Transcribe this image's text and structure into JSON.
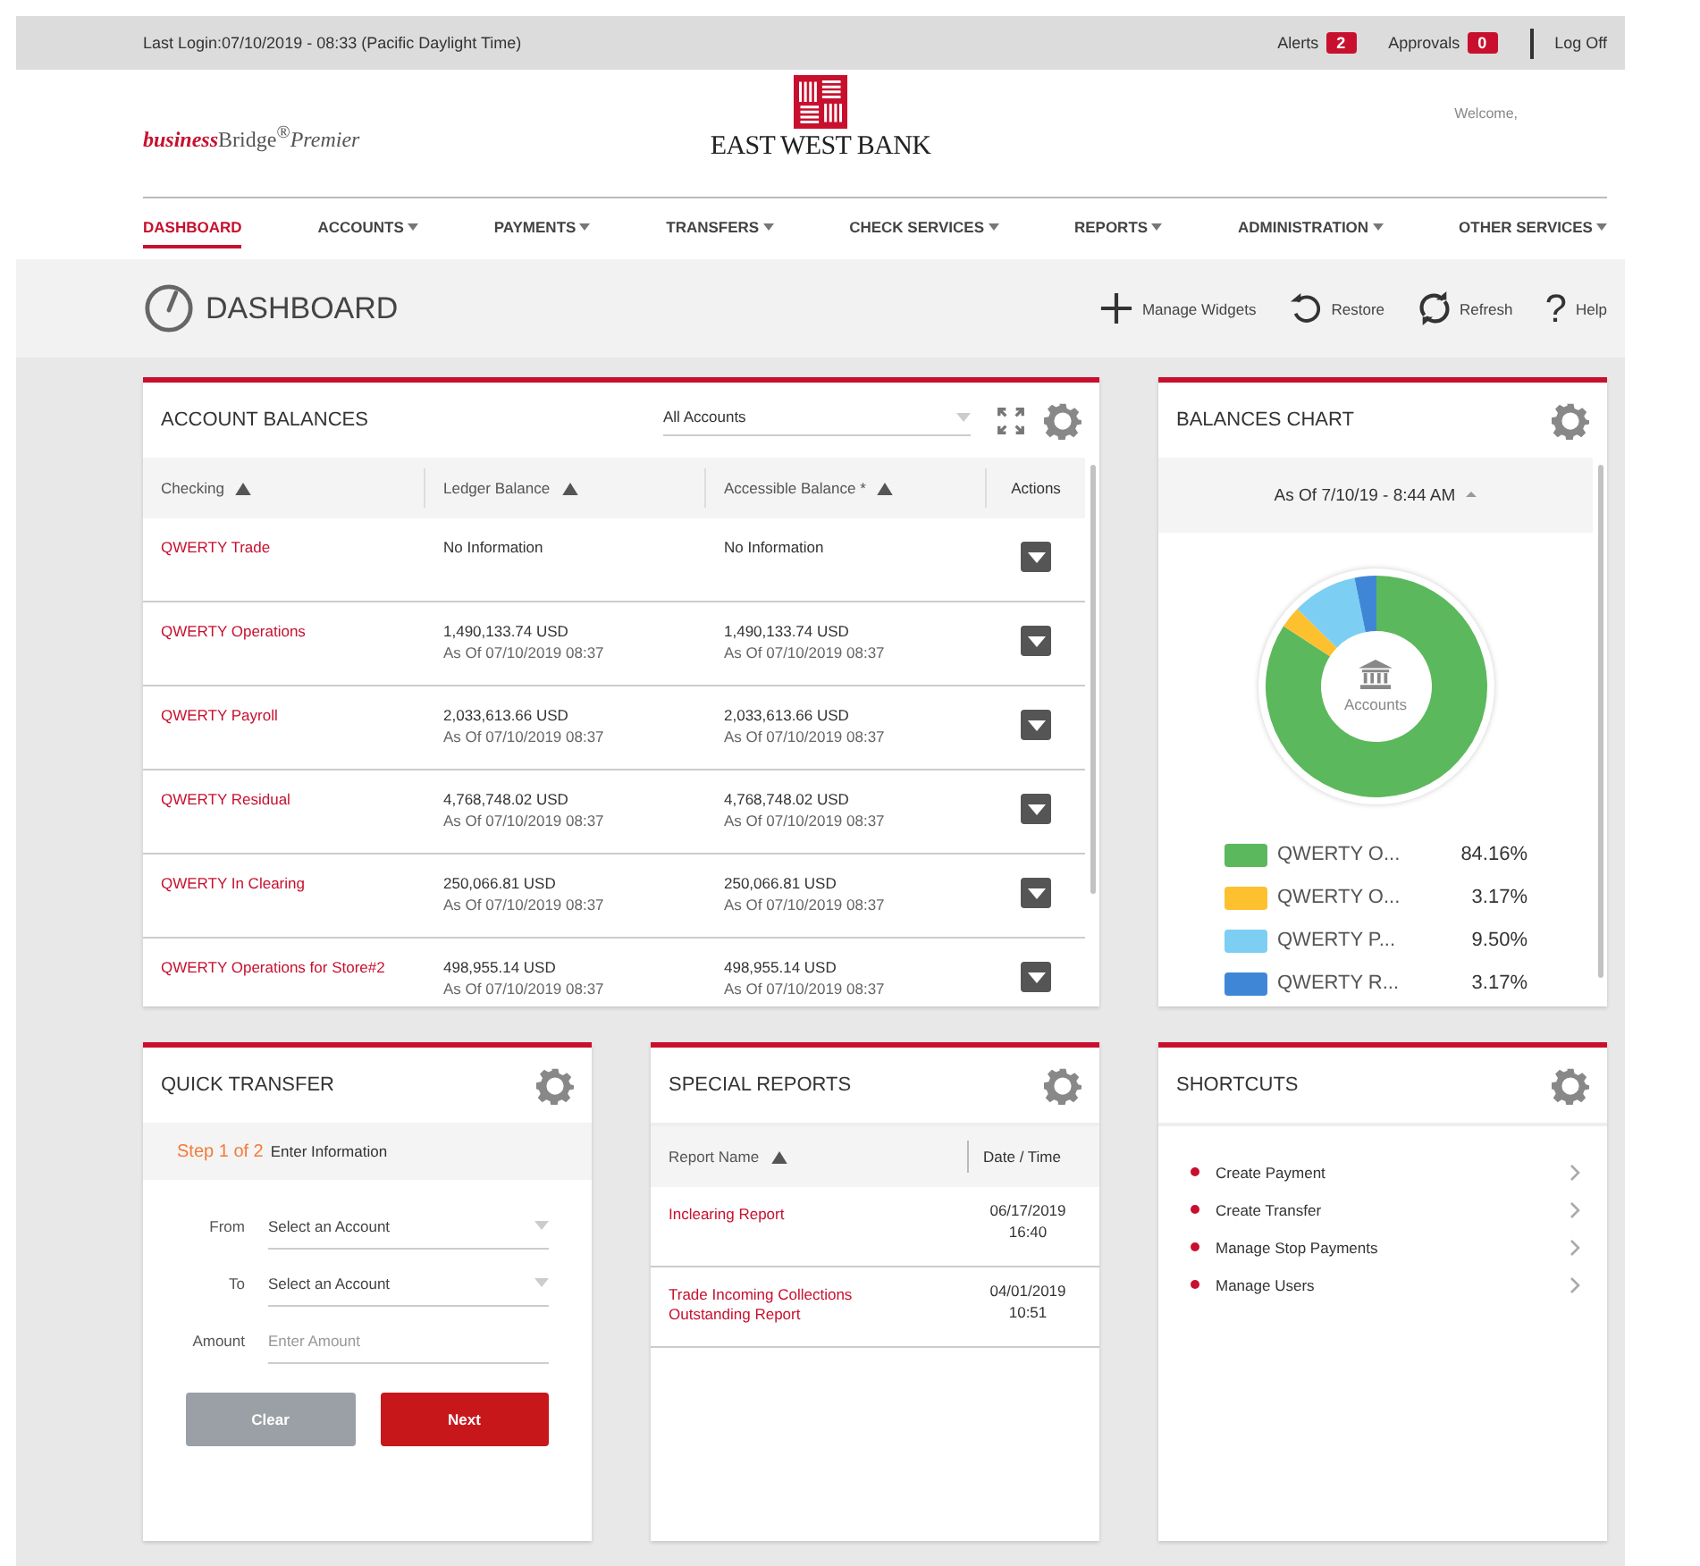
{
  "top_bar": {
    "last_login": "Last Login:07/10/2019 - 08:33 (Pacific Daylight Time)",
    "badges": [
      {
        "label": "Alerts",
        "count": "2"
      },
      {
        "label": "Approvals",
        "count": "0"
      }
    ],
    "logoff": "Log Off"
  },
  "header": {
    "product_logo": "**business**Bridge$^{®}$*Premier*",
    "bank_name": "EAST WEST BANK",
    "welcome": "Welcome,"
  },
  "nav": [
    {
      "label": "DASHBOARD",
      "selected": true,
      "dropdown": false
    },
    {
      "label": "ACCOUNTS",
      "selected": false,
      "dropdown": true
    },
    {
      "label": "PAYMENTS",
      "selected": false,
      "dropdown": true
    },
    {
      "label": "TRANSFERS",
      "selected": false,
      "dropdown": true
    },
    {
      "label": "CHECK SERVICES",
      "selected": false,
      "dropdown": true
    },
    {
      "label": "REPORTS",
      "selected": false,
      "dropdown": true
    },
    {
      "label": "ADMINISTRATION",
      "selected": false,
      "dropdown": true
    },
    {
      "label": "OTHER SERVICES",
      "selected": false,
      "dropdown": true
    }
  ],
  "page_title": "DASHBOARD",
  "toolbar": [
    {
      "kind": "plus",
      "label": "Manage Widgets"
    },
    {
      "kind": "restore",
      "label": "Restore"
    },
    {
      "kind": "refresh",
      "label": "Refresh"
    },
    {
      "kind": "help",
      "glyph": "?",
      "label": "Help"
    }
  ],
  "account_balances": {
    "title": "ACCOUNT BALANCES",
    "filter": "All Accounts",
    "columns": [
      {
        "label": "Checking",
        "sorted": true
      },
      {
        "label": "Ledger Balance",
        "sorted": true
      },
      {
        "label": "Accessible Balance *",
        "sorted": true
      },
      {
        "label": "Actions",
        "sorted": false
      }
    ],
    "rows": [
      {
        "name": "QWERTY Trade",
        "ledger": {
          "amount": "No Information"
        },
        "accessible": {
          "amount": "No Information"
        }
      },
      {
        "name": "QWERTY Operations",
        "ledger": {
          "amount": "1,490,133.74 USD",
          "as_of": "As Of 07/10/2019 08:37"
        },
        "accessible": {
          "amount": "1,490,133.74 USD",
          "as_of": "As Of 07/10/2019 08:37"
        }
      },
      {
        "name": "QWERTY Payroll",
        "ledger": {
          "amount": "2,033,613.66 USD",
          "as_of": "As Of 07/10/2019 08:37"
        },
        "accessible": {
          "amount": "2,033,613.66 USD",
          "as_of": "As Of 07/10/2019 08:37"
        }
      },
      {
        "name": "QWERTY Residual",
        "ledger": {
          "amount": "4,768,748.02 USD",
          "as_of": "As Of 07/10/2019 08:37"
        },
        "accessible": {
          "amount": "4,768,748.02 USD",
          "as_of": "As Of 07/10/2019 08:37"
        }
      },
      {
        "name": "QWERTY In Clearing",
        "ledger": {
          "amount": "250,066.81 USD",
          "as_of": "As Of 07/10/2019 08:37"
        },
        "accessible": {
          "amount": "250,066.81 USD",
          "as_of": "As Of 07/10/2019 08:37"
        }
      },
      {
        "name": "QWERTY Operations for Store#2",
        "ledger": {
          "amount": "498,955.14 USD",
          "as_of": "As Of 07/10/2019 08:37"
        },
        "accessible": {
          "amount": "498,955.14 USD",
          "as_of": "As Of 07/10/2019 08:37"
        }
      }
    ]
  },
  "balances_chart": {
    "title": "BALANCES CHART",
    "as_of": "As Of 7/10/19 - 8:44 AM",
    "center_label": "Accounts",
    "chart_data": {
      "type": "donut",
      "values": [
        84.16,
        3.17,
        9.5,
        3.17
      ]
    },
    "legend": [
      {
        "label": "QWERTY O...",
        "percent": "84.16%",
        "color": "#5cb85c"
      },
      {
        "label": "QWERTY O...",
        "percent": "3.17%",
        "color": "#fdc02f"
      },
      {
        "label": "QWERTY P...",
        "percent": "9.50%",
        "color": "#7ccff3"
      },
      {
        "label": "QWERTY R...",
        "percent": "3.17%",
        "color": "#3f87d6"
      }
    ]
  },
  "quick_transfer": {
    "title": "QUICK TRANSFER",
    "step": "Step 1 of 2",
    "step_label": "Enter Information",
    "fields": [
      {
        "kind": "select",
        "label": "From",
        "placeholder": "Select an Account"
      },
      {
        "kind": "select",
        "label": "To",
        "placeholder": "Select an Account"
      },
      {
        "kind": "input",
        "label": "Amount",
        "placeholder": "Enter Amount"
      }
    ],
    "buttons": [
      {
        "kind": "secondary",
        "label": "Clear"
      },
      {
        "kind": "primary",
        "label": "Next"
      }
    ]
  },
  "special_reports": {
    "title": "SPECIAL REPORTS",
    "columns": [
      {
        "label": "Report Name",
        "sorted": true
      },
      {
        "label": "Date / Time",
        "sorted": false
      }
    ],
    "rows": [
      {
        "name": "Inclearing Report",
        "date": "06/17/2019",
        "time": "16:40"
      },
      {
        "name": "Trade Incoming Collections Outstanding Report",
        "date": "04/01/2019",
        "time": "10:51"
      }
    ]
  },
  "shortcuts": {
    "title": "SHORTCUTS",
    "items": [
      "Create Payment",
      "Create Transfer",
      "Manage Stop Payments",
      "Manage Users"
    ]
  }
}
